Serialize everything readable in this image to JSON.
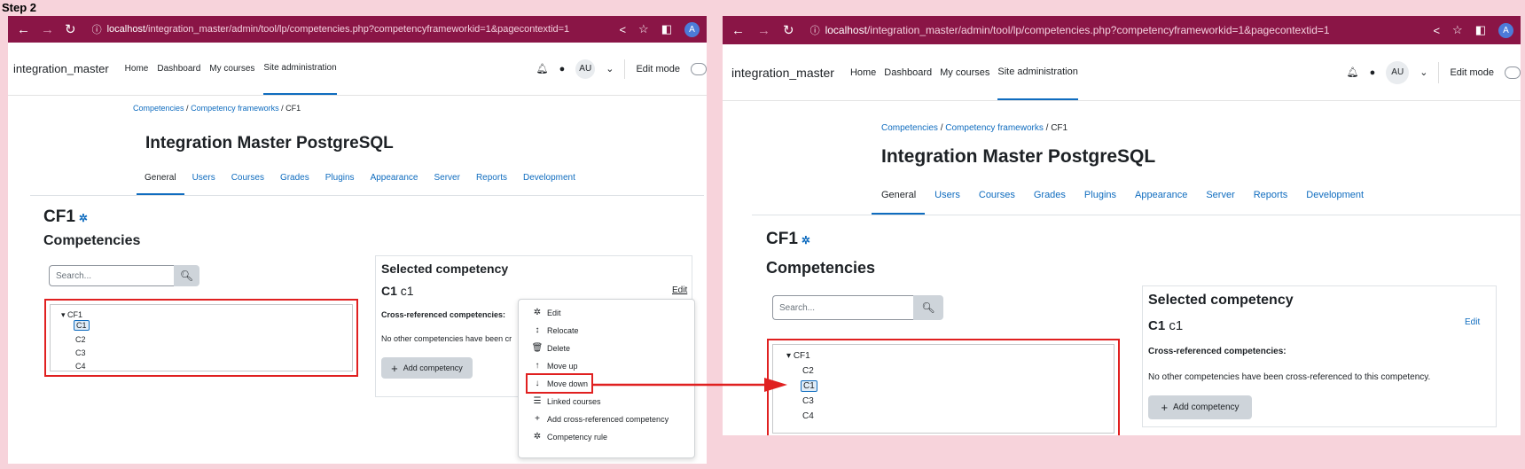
{
  "step_label": "Step 2",
  "browser": {
    "url_host": "localhost",
    "url_path": "/integration_master/admin/tool/lp/competencies.php?competencyframeworkid=1&pagecontextid=1",
    "profile_initial": "A"
  },
  "navbar": {
    "brand": "integration_master",
    "items": [
      {
        "label": "Home"
      },
      {
        "label": "Dashboard"
      },
      {
        "label": "My courses"
      },
      {
        "label": "Site administration"
      }
    ],
    "avatar": "AU",
    "edit_mode": "Edit mode"
  },
  "breadcrumb": {
    "competencies": "Competencies",
    "sep": "/",
    "frameworks": "Competency frameworks",
    "current": "CF1"
  },
  "page_title": "Integration Master PostgreSQL",
  "tabs": [
    {
      "label": "General"
    },
    {
      "label": "Users"
    },
    {
      "label": "Courses"
    },
    {
      "label": "Grades"
    },
    {
      "label": "Plugins"
    },
    {
      "label": "Appearance"
    },
    {
      "label": "Server"
    },
    {
      "label": "Reports"
    },
    {
      "label": "Development"
    }
  ],
  "framework_title": "CF1",
  "competencies_heading": "Competencies",
  "search_placeholder": "Search...",
  "tree_before": {
    "root": "CF1",
    "children": [
      "C1",
      "C2",
      "C3",
      "C4"
    ],
    "selected": "C1"
  },
  "tree_after": {
    "root": "CF1",
    "children": [
      "C2",
      "C1",
      "C3",
      "C4"
    ],
    "selected": "C1"
  },
  "selected_card": {
    "title": "Selected competency",
    "short_name": "C1",
    "id_number": "c1",
    "edit": "Edit",
    "xref_label": "Cross-referenced competencies:",
    "xref_none_truncated": "No other competencies have been cr",
    "xref_none": "No other competencies have been cross-referenced to this competency.",
    "add_button": "Add competency"
  },
  "context_menu": [
    {
      "label": "Edit",
      "icon": "gear-icon"
    },
    {
      "label": "Relocate",
      "icon": "updown-arrow-icon"
    },
    {
      "label": "Delete",
      "icon": "trash-icon"
    },
    {
      "label": "Move up",
      "icon": "arrow-up-icon"
    },
    {
      "label": "Move down",
      "icon": "arrow-down-icon"
    },
    {
      "label": "Linked courses",
      "icon": "list-icon"
    },
    {
      "label": "Add cross-referenced competency",
      "icon": "plus-icon"
    },
    {
      "label": "Competency rule",
      "icon": "gear-icon"
    }
  ],
  "colors": {
    "browser_bar": "#8a1546",
    "highlight": "#e02020",
    "link": "#0f6cbf",
    "background": "#f7d3db"
  }
}
